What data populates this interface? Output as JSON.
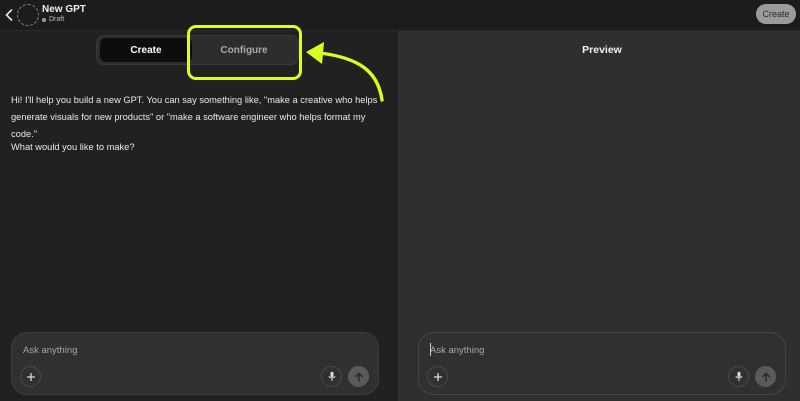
{
  "header": {
    "gpt_name": "New GPT",
    "status": "Draft",
    "create_button": "Create"
  },
  "tabs": [
    {
      "label": "Create",
      "active": true
    },
    {
      "label": "Configure",
      "active": false
    }
  ],
  "chat": {
    "intro_message": "Hi! I'll help you build a new GPT. You can say something like, \"make a creative who helps generate visuals for new products\" or \"make a software engineer who helps format my code.\"",
    "question": "What would you like to make?"
  },
  "composer_left": {
    "placeholder": "Ask anything"
  },
  "preview": {
    "title": "Preview",
    "composer": {
      "placeholder": "Ask anything"
    }
  },
  "colors": {
    "annotation": "#d9ff1f",
    "background": "#212121",
    "preview_background": "#2f2f2f"
  },
  "icons": [
    "chevron-left-icon",
    "plus-icon",
    "microphone-icon",
    "arrow-up-icon"
  ]
}
